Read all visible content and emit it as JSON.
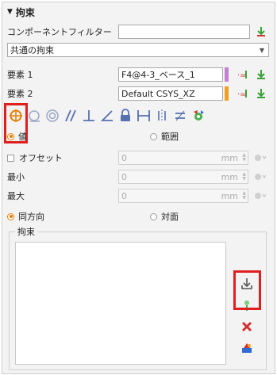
{
  "panel": {
    "title": "拘束",
    "collapse_glyph": "▼"
  },
  "component_filter": {
    "label": "コンポーネントフィルター",
    "value": "",
    "icon": "green-arrow-down-icon"
  },
  "constraint_type": {
    "selected": "共通の拘束"
  },
  "element1": {
    "label": "要素 1",
    "value": "F4@4-3_ベース_1",
    "color_bar": "#c47fd1"
  },
  "element2": {
    "label": "要素 2",
    "value": "Default CSYS_XZ",
    "color_bar": "#f0a020"
  },
  "tools": [
    {
      "name": "coincident-tool-icon",
      "glyph": "⊕",
      "active": true
    },
    {
      "name": "tangent-tool-icon",
      "glyph": "◯"
    },
    {
      "name": "concentric-tool-icon",
      "glyph": "◎"
    },
    {
      "name": "parallel-tool-icon",
      "glyph": "//"
    },
    {
      "name": "perpendicular-tool-icon",
      "glyph": "⊥"
    },
    {
      "name": "angle-tool-icon",
      "glyph": "∠"
    },
    {
      "name": "lock-tool-icon",
      "glyph": "🔒"
    },
    {
      "name": "distance-tool-icon",
      "glyph": "⊢⊣"
    },
    {
      "name": "symmetric-tool-icon",
      "glyph": "⫴"
    },
    {
      "name": "equal-tool-icon",
      "glyph": "="
    },
    {
      "name": "gear-tool-icon",
      "glyph": "⚙"
    }
  ],
  "mode": {
    "value_label": "値",
    "range_label": "範囲"
  },
  "offset": {
    "label": "オフセット",
    "value": "0",
    "unit": "mm"
  },
  "min": {
    "label": "最小",
    "value": "0",
    "unit": "mm"
  },
  "max": {
    "label": "最大",
    "value": "0",
    "unit": "mm"
  },
  "direction": {
    "same_label": "同方向",
    "opposite_label": "対面"
  },
  "constraints_group": {
    "title": "拘束"
  },
  "colors": {
    "accent": "#e67e00",
    "highlight_box": "#e02020",
    "green": "#4caf50",
    "red": "#d32f2f"
  }
}
